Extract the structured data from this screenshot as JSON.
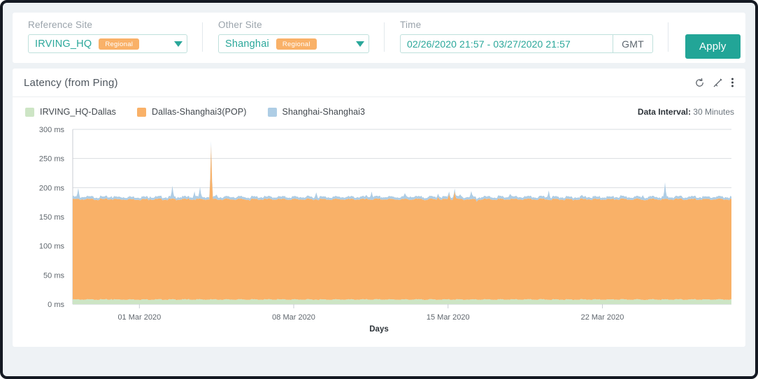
{
  "filters": {
    "reference_site": {
      "label": "Reference Site",
      "value": "IRVING_HQ",
      "badge": "Regional",
      "caret_icon": "chevron-down-icon"
    },
    "other_site": {
      "label": "Other Site",
      "value": "Shanghai",
      "badge": "Regional",
      "caret_icon": "chevron-down-icon"
    },
    "time": {
      "label": "Time",
      "value": "02/26/2020 21:57 - 03/27/2020 21:57",
      "timezone": "GMT"
    },
    "apply_label": "Apply"
  },
  "card": {
    "title": "Latency (from Ping)",
    "tools": [
      {
        "name": "refresh-icon",
        "title": "Refresh"
      },
      {
        "name": "trend-line-icon",
        "title": "Line"
      },
      {
        "name": "more-options-icon",
        "title": "More"
      }
    ],
    "data_interval_label": "Data Interval:",
    "data_interval_value": "30 Minutes"
  },
  "colors": {
    "accent_teal": "#22a597",
    "badge_orange": "#f9b168",
    "series_green": "#cde5c5",
    "series_orange": "#f9b168",
    "series_blue": "#aecde5",
    "page_bg": "#eef2f5",
    "grid": "#d9dde1"
  },
  "chart_data": {
    "type": "area",
    "stacked": true,
    "title": "Latency (from Ping)",
    "xlabel": "Days",
    "ylabel": "",
    "ylim": [
      0,
      300
    ],
    "yticks": [
      0,
      50,
      100,
      150,
      200,
      250,
      300
    ],
    "ytick_labels": [
      "0 ms",
      "50 ms",
      "100 ms",
      "150 ms",
      "200 ms",
      "250 ms",
      "300 ms"
    ],
    "xticks": [
      "01 Mar 2020",
      "08 Mar 2020",
      "15 Mar 2020",
      "22 Mar 2020"
    ],
    "xtick_positions": [
      0.1012,
      0.3355,
      0.5698,
      0.8041
    ],
    "x_range": [
      "02/26/2020 21:57",
      "03/27/2020 21:57"
    ],
    "grid": true,
    "legend_position": "top-left",
    "units": "ms",
    "interval_minutes": 30,
    "series": [
      {
        "name": "IRVING_HQ-Dallas",
        "color": "#cde5c5",
        "baseline": 8,
        "values": [
          8,
          8,
          8,
          8,
          8,
          8,
          8,
          9,
          8,
          8,
          8,
          8,
          8,
          8,
          8,
          8,
          8,
          8,
          8,
          8,
          8,
          9,
          8,
          8,
          8,
          8,
          8,
          8,
          8,
          8,
          8,
          8,
          8,
          8,
          8,
          8,
          8,
          9,
          8,
          8,
          8,
          8,
          8,
          8,
          8,
          8,
          8,
          8,
          8,
          8,
          8,
          8,
          8,
          8,
          8,
          8,
          8,
          8,
          8,
          8,
          8,
          8,
          8,
          8,
          8,
          8,
          8,
          8,
          8,
          8,
          8,
          8,
          8,
          8,
          8,
          8,
          8,
          8,
          8,
          8,
          8,
          8,
          8,
          8,
          8,
          8,
          8,
          8,
          8,
          8,
          8,
          8,
          8,
          8,
          8,
          8,
          8,
          8,
          8,
          8,
          8,
          8,
          8,
          8,
          8,
          8,
          8,
          8,
          8,
          8,
          8,
          8,
          8,
          8,
          8,
          8,
          8,
          8,
          8,
          8
        ]
      },
      {
        "name": "Dallas-Shanghai3(POP)",
        "color": "#f9b168",
        "baseline": 172,
        "values": [
          172,
          172,
          172,
          172,
          172,
          173,
          172,
          172,
          172,
          172,
          172,
          172,
          172,
          172,
          173,
          172,
          172,
          172,
          172,
          172,
          172,
          172,
          172,
          172,
          172,
          265,
          172,
          172,
          172,
          172,
          172,
          172,
          170,
          172,
          172,
          172,
          172,
          172,
          172,
          172,
          172,
          172,
          172,
          172,
          172,
          172,
          172,
          172,
          172,
          172,
          172,
          172,
          172,
          172,
          172,
          172,
          172,
          172,
          172,
          172,
          172,
          172,
          172,
          172,
          172,
          172,
          176,
          172,
          180,
          186,
          172,
          172,
          172,
          168,
          172,
          172,
          172,
          172,
          172,
          172,
          172,
          172,
          172,
          172,
          172,
          172,
          172,
          172,
          172,
          172,
          172,
          172,
          172,
          172,
          172,
          172,
          172,
          172,
          172,
          172,
          172,
          172,
          172,
          172,
          172,
          172,
          172,
          172,
          172,
          172,
          172,
          172,
          172,
          172,
          172,
          172,
          172,
          172,
          172,
          172
        ]
      },
      {
        "name": "Shanghai-Shanghai3",
        "color": "#aecde5",
        "baseline": 4,
        "values": [
          6,
          18,
          5,
          4,
          4,
          4,
          4,
          5,
          4,
          4,
          4,
          4,
          4,
          4,
          5,
          4,
          4,
          4,
          22,
          5,
          4,
          4,
          14,
          20,
          4,
          6,
          8,
          4,
          4,
          5,
          4,
          4,
          4,
          4,
          4,
          4,
          4,
          4,
          4,
          4,
          4,
          4,
          4,
          4,
          12,
          4,
          4,
          4,
          4,
          4,
          4,
          4,
          4,
          6,
          14,
          4,
          4,
          4,
          4,
          4,
          10,
          6,
          4,
          4,
          4,
          4,
          6,
          4,
          4,
          5,
          8,
          4,
          14,
          4,
          4,
          4,
          4,
          6,
          4,
          10,
          4,
          4,
          4,
          4,
          4,
          4,
          16,
          4,
          4,
          4,
          4,
          4,
          6,
          4,
          4,
          4,
          4,
          4,
          4,
          6,
          4,
          4,
          4,
          8,
          4,
          4,
          4,
          28,
          4,
          4,
          4,
          4,
          5,
          4,
          4,
          4,
          4,
          4,
          4,
          4
        ]
      }
    ]
  }
}
